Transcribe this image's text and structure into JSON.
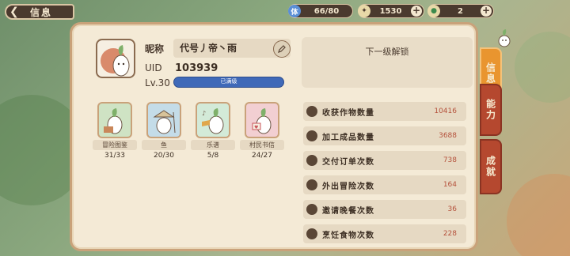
{
  "header": {
    "back_label": "信息",
    "resources": [
      {
        "icon": "stamina-icon",
        "icon_text": "体",
        "value": "66/80"
      },
      {
        "icon": "coin-icon",
        "value": "1530"
      },
      {
        "icon": "gem-icon",
        "value": "2"
      }
    ]
  },
  "profile": {
    "nickname_label": "昵称",
    "nickname": "代号丿帝丶雨",
    "uid_label": "UID",
    "uid": "103939",
    "level": "Lv.30",
    "level_status": "已满级",
    "level_progress": 1.0,
    "next_unlock_label": "下一级解锁"
  },
  "collections": [
    {
      "label": "冒险图鉴",
      "count": "31/33"
    },
    {
      "label": "鱼",
      "count": "20/30"
    },
    {
      "label": "乐谱",
      "count": "5/8"
    },
    {
      "label": "村民书信",
      "count": "24/27"
    }
  ],
  "stats": [
    {
      "label": "收获作物数量",
      "value": "10416"
    },
    {
      "label": "加工成品数量",
      "value": "3688"
    },
    {
      "label": "交付订单次数",
      "value": "738"
    },
    {
      "label": "外出冒险次数",
      "value": "164"
    },
    {
      "label": "邀请晚餐次数",
      "value": "36"
    },
    {
      "label": "烹饪食物次数",
      "value": "228"
    }
  ],
  "tabs": [
    {
      "label": "信息",
      "active": true
    },
    {
      "label": "能力",
      "active": false
    },
    {
      "label": "成就",
      "active": false
    }
  ],
  "colors": {
    "panel": "#f4ead6",
    "accent_orange": "#e9952f",
    "tab_red": "#b5482f",
    "level_bar": "#3f69b8",
    "stat_value": "#b5523c"
  }
}
